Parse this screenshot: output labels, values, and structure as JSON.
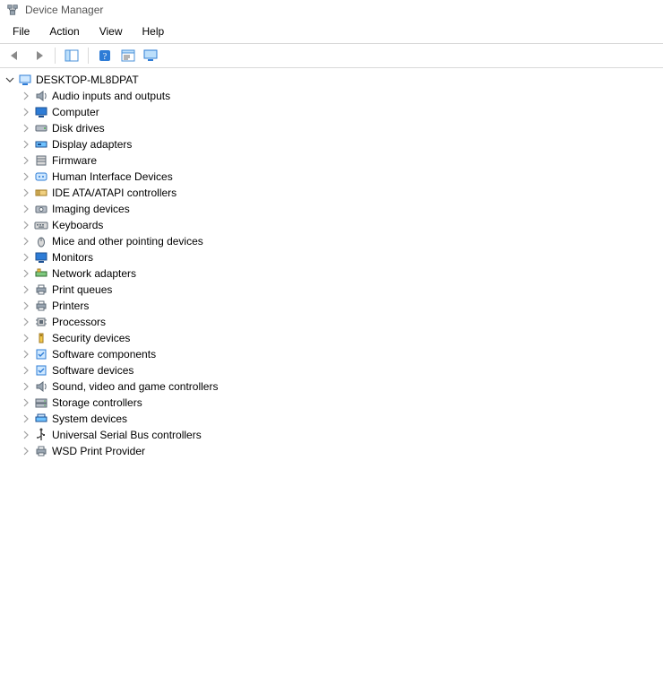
{
  "window": {
    "title": "Device Manager"
  },
  "menu": {
    "file": "File",
    "action": "Action",
    "view": "View",
    "help": "Help"
  },
  "toolbar": {
    "back": "Back",
    "forward": "Forward",
    "show_hide_tree": "Show/Hide Console Tree",
    "help_btn": "Help",
    "properties": "Properties",
    "monitor": "Update driver"
  },
  "tree": {
    "root": {
      "label": "DESKTOP-ML8DPAT",
      "expanded": true,
      "icon": "computer-icon"
    },
    "items": [
      {
        "label": "Audio inputs and outputs",
        "icon": "speaker-icon"
      },
      {
        "label": "Computer",
        "icon": "monitor-icon"
      },
      {
        "label": "Disk drives",
        "icon": "disk-icon"
      },
      {
        "label": "Display adapters",
        "icon": "display-adapter-icon"
      },
      {
        "label": "Firmware",
        "icon": "firmware-icon"
      },
      {
        "label": "Human Interface Devices",
        "icon": "hid-icon"
      },
      {
        "label": "IDE ATA/ATAPI controllers",
        "icon": "ide-icon"
      },
      {
        "label": "Imaging devices",
        "icon": "imaging-icon"
      },
      {
        "label": "Keyboards",
        "icon": "keyboard-icon"
      },
      {
        "label": "Mice and other pointing devices",
        "icon": "mouse-icon"
      },
      {
        "label": "Monitors",
        "icon": "monitor-icon"
      },
      {
        "label": "Network adapters",
        "icon": "network-icon"
      },
      {
        "label": "Print queues",
        "icon": "printer-icon"
      },
      {
        "label": "Printers",
        "icon": "printer-icon"
      },
      {
        "label": "Processors",
        "icon": "cpu-icon"
      },
      {
        "label": "Security devices",
        "icon": "security-icon"
      },
      {
        "label": "Software components",
        "icon": "software-icon"
      },
      {
        "label": "Software devices",
        "icon": "software-icon"
      },
      {
        "label": "Sound, video and game controllers",
        "icon": "speaker-icon"
      },
      {
        "label": "Storage controllers",
        "icon": "storage-icon"
      },
      {
        "label": "System devices",
        "icon": "system-icon"
      },
      {
        "label": "Universal Serial Bus controllers",
        "icon": "usb-icon"
      },
      {
        "label": "WSD Print Provider",
        "icon": "printer-icon"
      }
    ]
  }
}
